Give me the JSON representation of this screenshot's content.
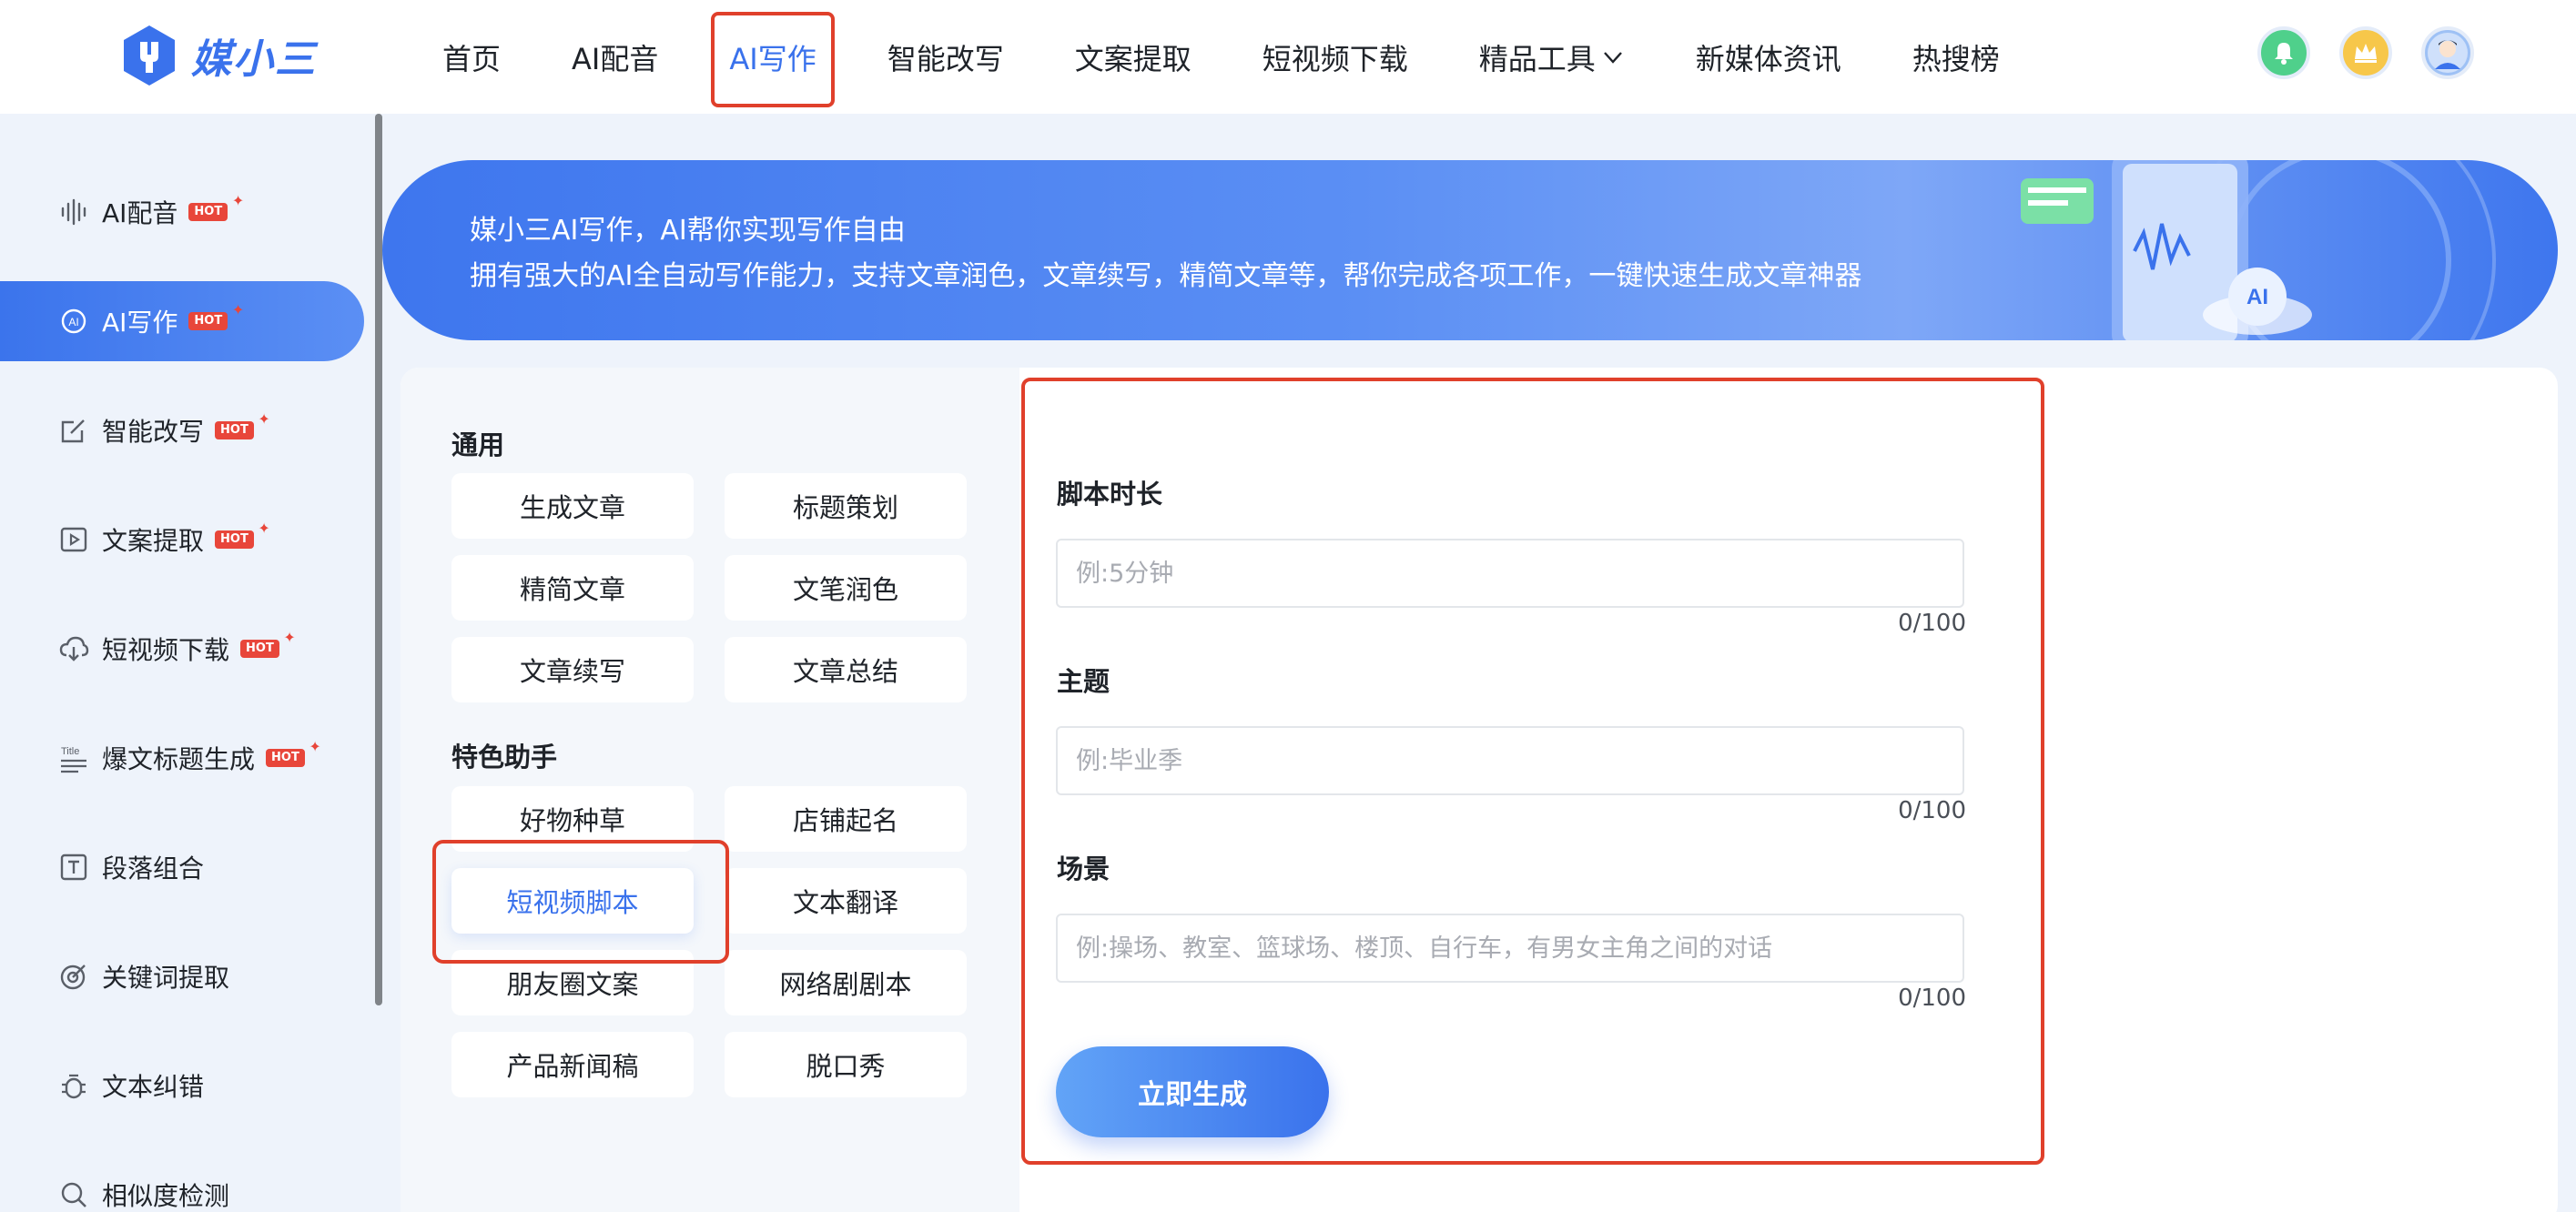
{
  "brand": {
    "name": "媒小三"
  },
  "nav": {
    "items": [
      {
        "label": "首页"
      },
      {
        "label": "AI配音"
      },
      {
        "label": "AI写作"
      },
      {
        "label": "智能改写"
      },
      {
        "label": "文案提取"
      },
      {
        "label": "短视频下载"
      },
      {
        "label": "精品工具"
      },
      {
        "label": "新媒体资讯"
      },
      {
        "label": "热搜榜"
      }
    ],
    "active": "AI写作"
  },
  "sidebar": {
    "hot_label": "HOT",
    "items": [
      {
        "label": "AI配音",
        "hot": true
      },
      {
        "label": "AI写作",
        "hot": true
      },
      {
        "label": "智能改写",
        "hot": true
      },
      {
        "label": "文案提取",
        "hot": true
      },
      {
        "label": "短视频下载",
        "hot": true
      },
      {
        "label": "爆文标题生成",
        "hot": true
      },
      {
        "label": "段落组合",
        "hot": false
      },
      {
        "label": "关键词提取",
        "hot": false
      },
      {
        "label": "文本纠错",
        "hot": false
      },
      {
        "label": "相似度检测",
        "hot": false
      }
    ]
  },
  "banner": {
    "title": "媒小三AI写作，AI帮你实现写作自由",
    "subtitle": "拥有强大的AI全自动写作能力，支持文章润色，文章续写，精简文章等，帮你完成各项工作，一键快速生成文章神器",
    "art_label": "AI"
  },
  "tools": {
    "general_title": "通用",
    "general": [
      "生成文章",
      "标题策划",
      "精简文章",
      "文笔润色",
      "文章续写",
      "文章总结"
    ],
    "featured_title": "特色助手",
    "featured": [
      "好物种草",
      "店铺起名",
      "短视频脚本",
      "文本翻译",
      "朋友圈文案",
      "网络剧剧本",
      "产品新闻稿",
      "脱口秀"
    ],
    "active": "短视频脚本"
  },
  "form": {
    "duration": {
      "label": "脚本时长",
      "placeholder": "例:5分钟",
      "value": "",
      "counter": "0/100"
    },
    "topic": {
      "label": "主题",
      "placeholder": "例:毕业季",
      "value": "",
      "counter": "0/100"
    },
    "scene": {
      "label": "场景",
      "placeholder": "例:操场、教室、篮球场、楼顶、自行车，有男女主角之间的对话",
      "value": "",
      "counter": "0/100"
    },
    "submit_label": "立即生成"
  },
  "colors": {
    "accent": "#3a72ec",
    "hot": "#e8463a",
    "highlight": "#e0402b"
  }
}
